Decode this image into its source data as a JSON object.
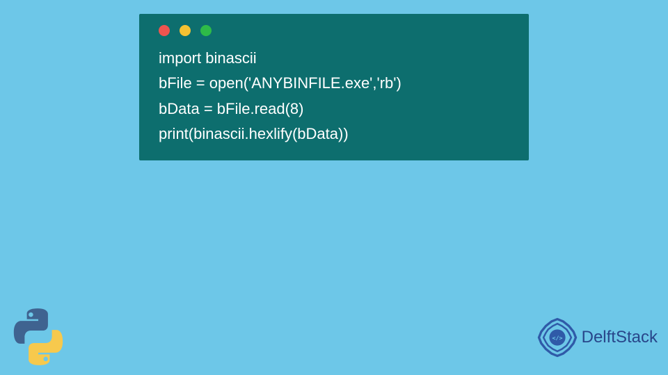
{
  "code": {
    "lines": [
      "import binascii",
      "bFile = open('ANYBINFILE.exe','rb')",
      "bData = bFile.read(8)",
      "print(binascii.hexlify(bData))"
    ]
  },
  "brand": {
    "name": "DelftStack"
  },
  "colors": {
    "background": "#6dc7e8",
    "code_window": "#0d6e6e",
    "code_text": "#ffffff",
    "brand_color": "#28468a",
    "python_blue": "#3f6390",
    "python_yellow": "#f7c94d"
  },
  "icons": {
    "bottom_left": "python-logo",
    "brand": "delftstack-logo"
  }
}
